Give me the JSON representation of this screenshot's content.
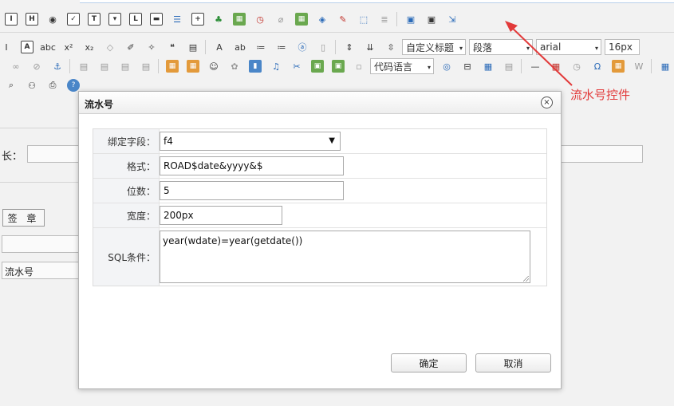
{
  "annotation": {
    "label": "流水号控件",
    "color": "#e23a3a"
  },
  "toolbar": {
    "row1": [
      "text-field-icon",
      "text-area-icon",
      "radio-icon",
      "checkbox-icon",
      "list-field-icon",
      "select-icon",
      "label-icon",
      "button-icon",
      "list-view-icon",
      "plus-icon",
      "user-select-icon",
      "org-select-icon",
      "date-icon",
      "attachment-icon",
      "grid-icon",
      "macro-icon",
      "edit-icon",
      "select-area-icon",
      "serial-number-icon",
      "save-icon",
      "save-as-icon",
      "import-icon"
    ],
    "row2_combos": {
      "heading": "自定义标题",
      "paragraph": "段落",
      "font": "arial",
      "size": "16px"
    },
    "row3_combos": {
      "code_language": "代码语言"
    }
  },
  "background": {
    "length_label": "长：",
    "sign_button": "签 章",
    "serial_field_value": "流水号"
  },
  "dialog": {
    "title": "流水号",
    "close": "×",
    "fields": {
      "bind_field": {
        "label": "绑定字段：",
        "value": "f4"
      },
      "format": {
        "label": "格式：",
        "value": "ROAD$date&yyyy&$"
      },
      "digits": {
        "label": "位数：",
        "value": "5"
      },
      "width": {
        "label": "宽度：",
        "value": "200px"
      },
      "sql_condition": {
        "label": "SQL条件：",
        "value": "year(wdate)=year(getdate())"
      }
    },
    "ok_label": "确定",
    "cancel_label": "取消"
  }
}
